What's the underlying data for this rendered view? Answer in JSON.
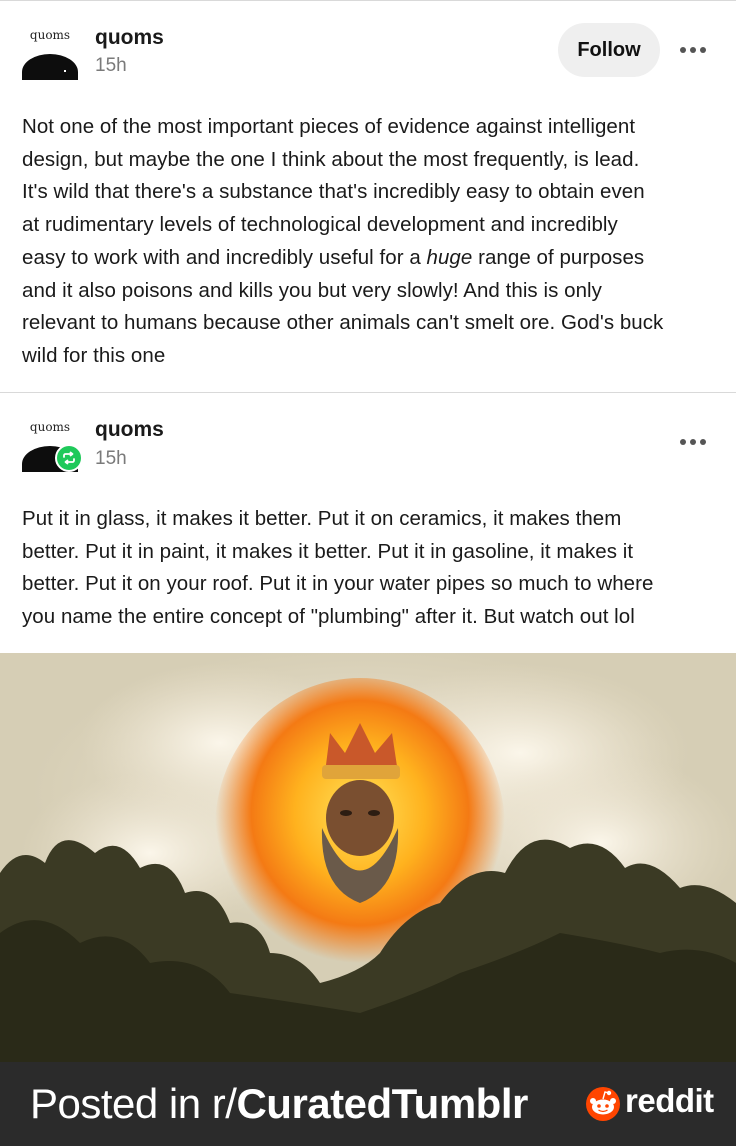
{
  "posts": [
    {
      "avatar_label": "quoms",
      "username": "quoms",
      "time": "15h",
      "follow_label": "Follow",
      "body_lines": [
        "Not one of the most important pieces of evidence against intelligent",
        "design, but maybe the one I think about the most frequently, is lead.",
        "It's wild that there's a substance that's incredibly easy to obtain even",
        "at rudimentary levels of technological development and incredibly",
        "easy to work with and incredibly useful for a ",
        "huge",
        " range of purposes",
        "and it also poisons and kills you but very slowly! And this is only",
        "relevant to humans because other animals can't smelt ore. God's buck",
        "wild for this one"
      ]
    },
    {
      "avatar_label": "quoms",
      "username": "quoms",
      "time": "15h",
      "body_lines": [
        "Put it in glass, it makes it better. Put it on ceramics, it makes them",
        "better. Put it in paint, it makes it better. Put it in gasoline, it makes it",
        "better. Put it on your roof. Put it in your water pipes so much to where",
        "you name the entire concept of \"plumbing\" after it. But watch out lol"
      ]
    }
  ],
  "footer": {
    "prefix": "Posted in r/",
    "subreddit": "CuratedTumblr",
    "brand": "reddit"
  },
  "icons": {
    "more": "more-horizontal-icon",
    "reblog": "reblog-icon",
    "brand_logo": "reddit-logo-icon"
  },
  "colors": {
    "reblog_badge": "#1fc95a",
    "footer_bg": "#2b2b2b",
    "reddit_orange": "#ff4500"
  }
}
